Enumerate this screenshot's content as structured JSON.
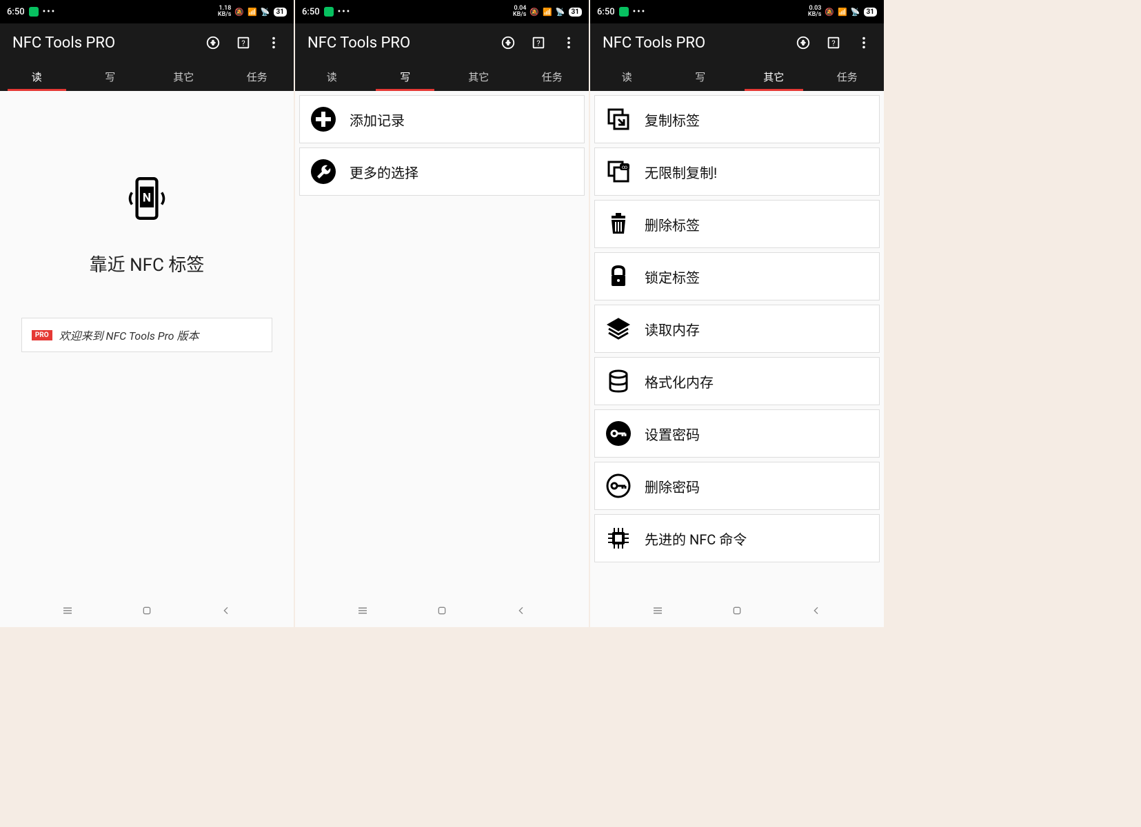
{
  "status": {
    "time": "6:50",
    "battery": "31"
  },
  "kbs": [
    "1.18",
    "0.04",
    "0.03"
  ],
  "app_title": "NFC Tools PRO",
  "tabs": {
    "read": "读",
    "write": "写",
    "other": "其它",
    "tasks": "任务"
  },
  "screen1": {
    "hero": "靠近 NFC 标签",
    "pro": "PRO",
    "welcome": "欢迎来到 NFC Tools Pro 版本"
  },
  "screen2": {
    "items": [
      {
        "label": "添加记录"
      },
      {
        "label": "更多的选择"
      }
    ]
  },
  "screen3": {
    "items": [
      {
        "label": "复制标签"
      },
      {
        "label": "无限制复制!"
      },
      {
        "label": "删除标签"
      },
      {
        "label": "锁定标签"
      },
      {
        "label": "读取内存"
      },
      {
        "label": "格式化内存"
      },
      {
        "label": "设置密码"
      },
      {
        "label": "删除密码"
      },
      {
        "label": "先进的 NFC 命令"
      }
    ]
  }
}
